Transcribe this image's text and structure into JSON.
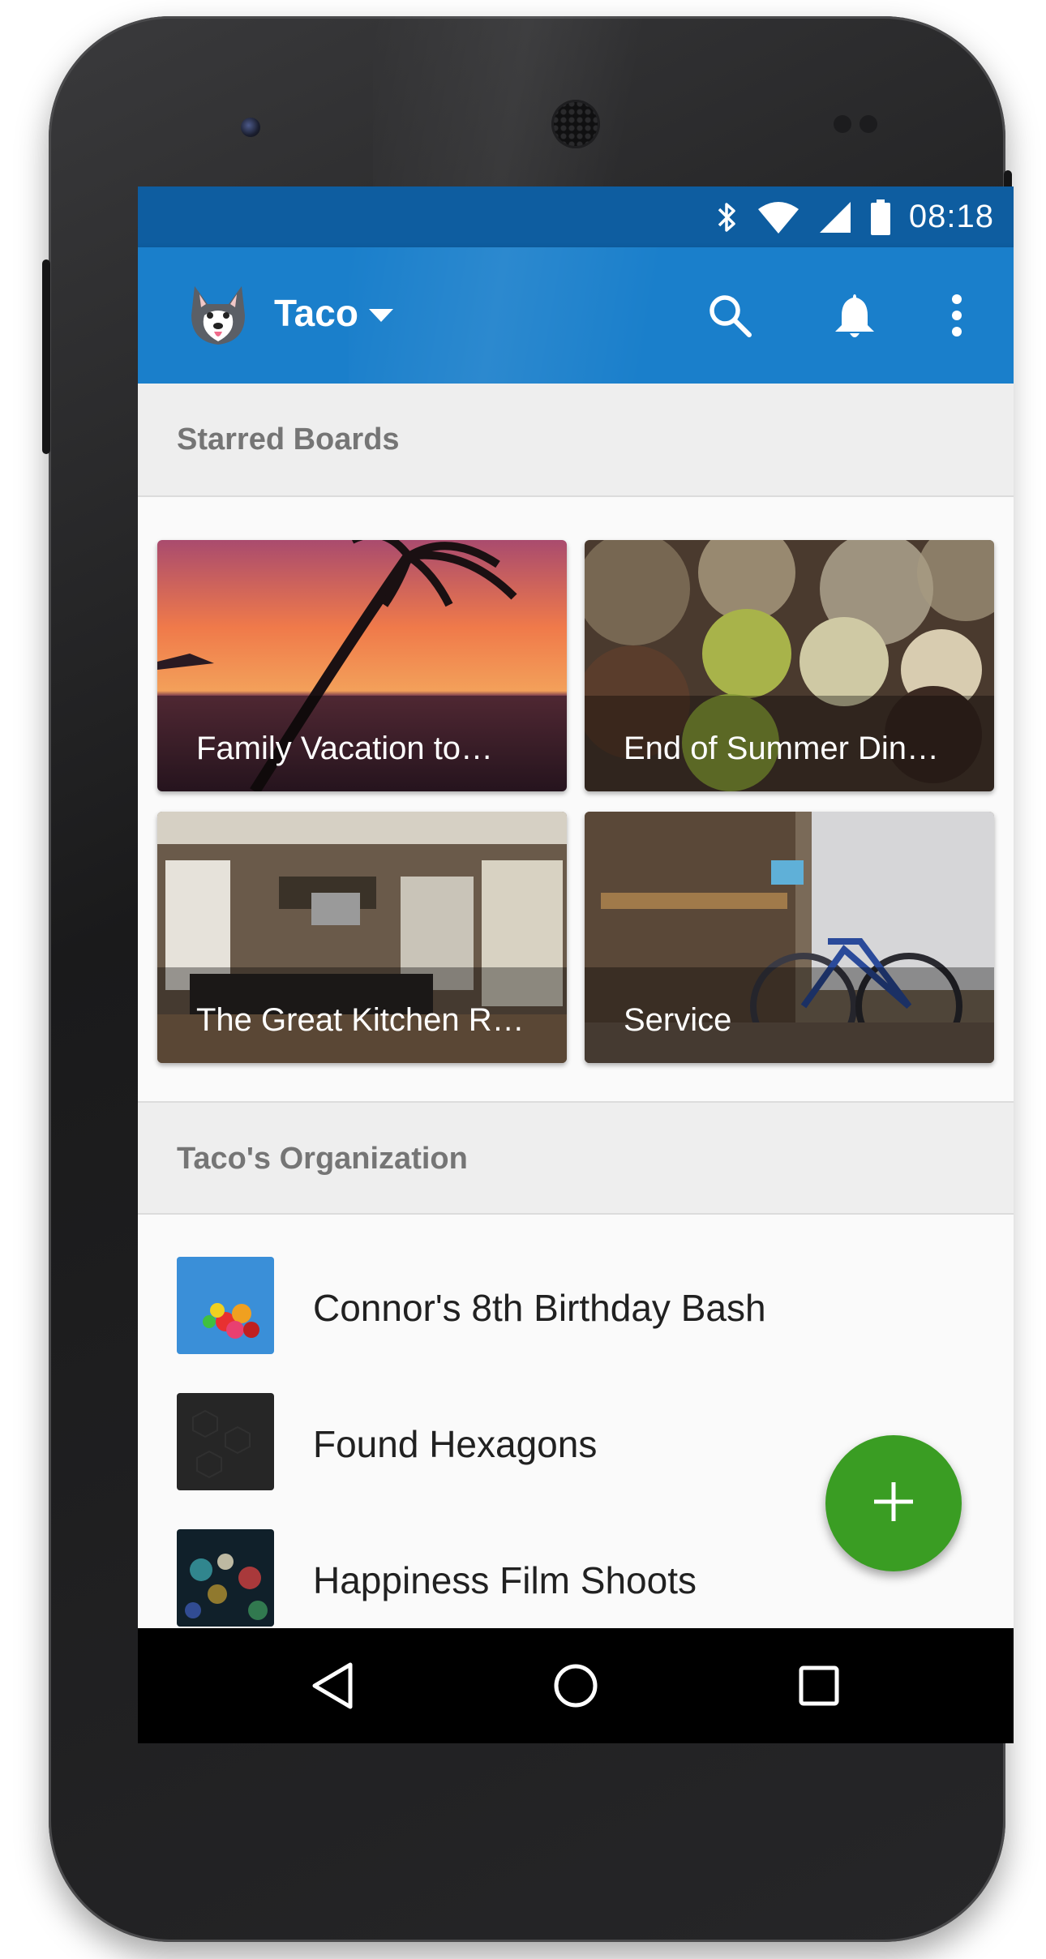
{
  "status_bar": {
    "time": "08:18",
    "icons": [
      "bluetooth-icon",
      "wifi-icon",
      "cell-signal-icon",
      "battery-icon"
    ]
  },
  "app_bar": {
    "title": "Taco",
    "avatar_icon": "husky-avatar",
    "actions": [
      "search-icon",
      "notifications-bell-icon",
      "more-vert-icon"
    ],
    "color": "#1a7fcb"
  },
  "starred_section": {
    "title": "Starred Boards",
    "boards": [
      {
        "label": "Family Vacation to…",
        "image": "sunset-palm"
      },
      {
        "label": "End of Summer Din…",
        "image": "truffles"
      },
      {
        "label": "The Great Kitchen R…",
        "image": "kitchen"
      },
      {
        "label": "Service",
        "image": "bike-shop"
      }
    ]
  },
  "org_section": {
    "title": "Taco's Organization",
    "items": [
      {
        "label": "Connor's 8th Birthday Bash",
        "image": "balloons"
      },
      {
        "label": "Found Hexagons",
        "image": "dark-hexagons"
      },
      {
        "label": "Happiness Film Shoots",
        "image": "bokeh-lights"
      }
    ]
  },
  "fab": {
    "icon": "add-icon",
    "color": "#3a9d23"
  },
  "nav_bar": {
    "buttons": [
      "back-icon",
      "home-icon",
      "recents-icon"
    ]
  }
}
